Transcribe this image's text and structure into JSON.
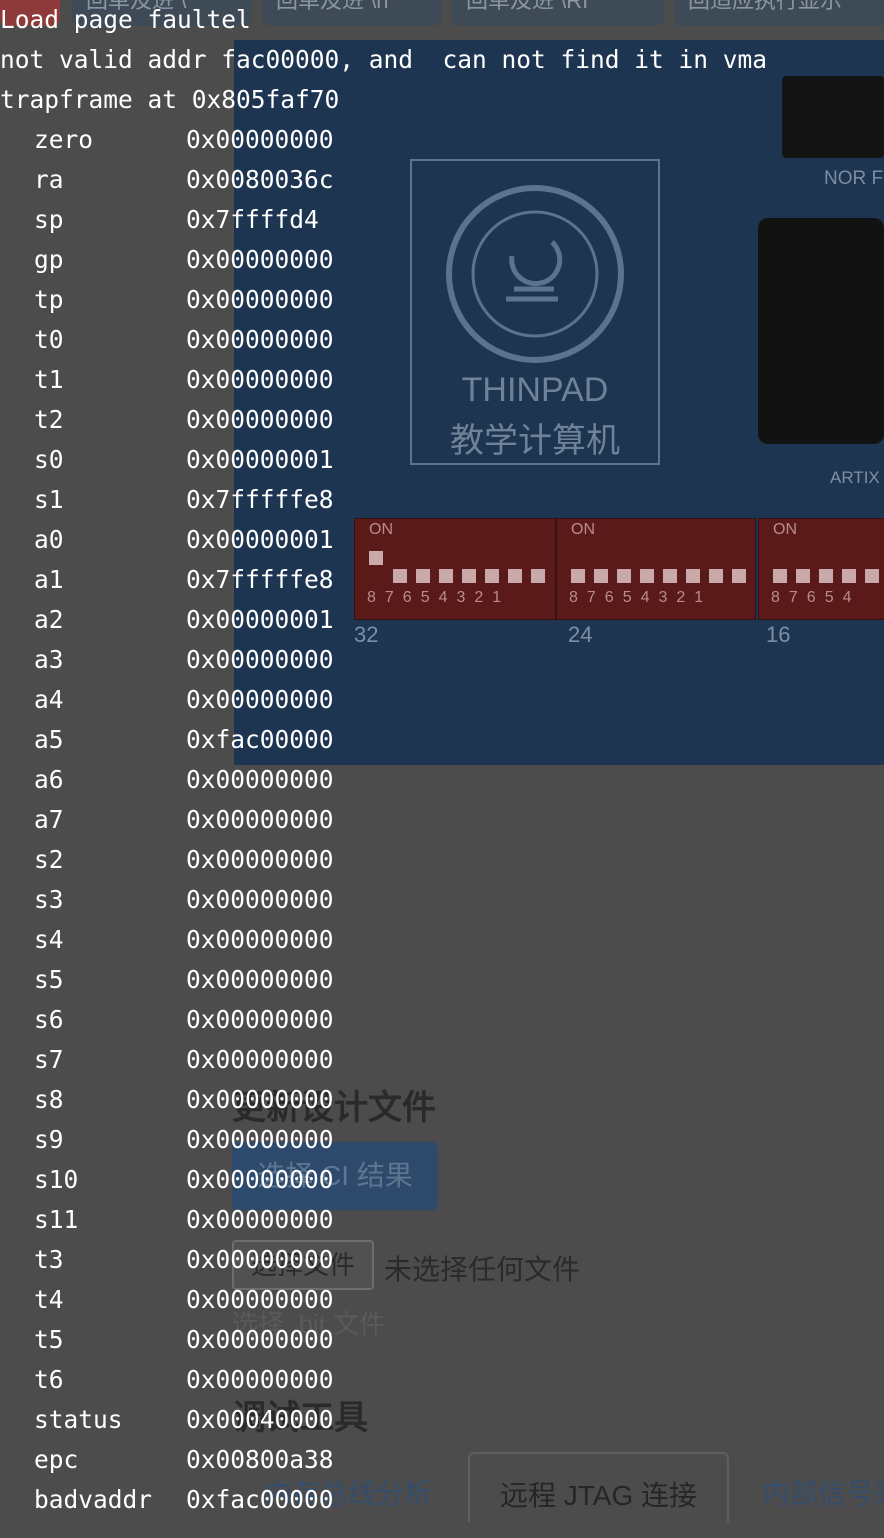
{
  "browser_tabs": [
    {
      "label": "回单及进 \\"
    },
    {
      "label": "回单及进 \\n"
    },
    {
      "label": "回单及进 \\RI"
    },
    {
      "label": "回适应执行显示"
    }
  ],
  "board": {
    "logo_title": "THINPAD",
    "logo_subtitle": "教学计算机",
    "nor_label": "NOR F",
    "artix_label": "ARTIX",
    "switch_banks": [
      {
        "on": "ON",
        "digits": "87654321",
        "index": "32"
      },
      {
        "on": "ON",
        "digits": "87654321",
        "index": "24"
      },
      {
        "on": "ON",
        "digits": "87654",
        "index": "16"
      }
    ]
  },
  "update_section": {
    "title": "更新设计文件",
    "select_ci_button": "选择 CI 结果",
    "choose_file_button": "选择文件",
    "file_status": "未选择任何文件",
    "hint": "选择 .bit 文件"
  },
  "debug_section": {
    "title": "调试工具",
    "tabs": [
      {
        "label": "内存总线分析"
      },
      {
        "label": "远程 JTAG 连接"
      },
      {
        "label": "内部信号采"
      }
    ]
  },
  "terminal": {
    "lines": [
      "Load page faultel",
      "not valid addr fac00000, and  can not find it in vma",
      "trapframe at 0x805faf70"
    ],
    "registers": [
      {
        "name": "zero",
        "value": "0x00000000"
      },
      {
        "name": "ra",
        "value": "0x0080036c"
      },
      {
        "name": "sp",
        "value": "0x7ffffd4"
      },
      {
        "name": "gp",
        "value": "0x00000000"
      },
      {
        "name": "tp",
        "value": "0x00000000"
      },
      {
        "name": "t0",
        "value": "0x00000000"
      },
      {
        "name": "t1",
        "value": "0x00000000"
      },
      {
        "name": "t2",
        "value": "0x00000000"
      },
      {
        "name": "s0",
        "value": "0x00000001"
      },
      {
        "name": "s1",
        "value": "0x7fffffe8"
      },
      {
        "name": "a0",
        "value": "0x00000001"
      },
      {
        "name": "a1",
        "value": "0x7fffffe8"
      },
      {
        "name": "a2",
        "value": "0x00000001"
      },
      {
        "name": "a3",
        "value": "0x00000000"
      },
      {
        "name": "a4",
        "value": "0x00000000"
      },
      {
        "name": "a5",
        "value": "0xfac00000"
      },
      {
        "name": "a6",
        "value": "0x00000000"
      },
      {
        "name": "a7",
        "value": "0x00000000"
      },
      {
        "name": "s2",
        "value": "0x00000000"
      },
      {
        "name": "s3",
        "value": "0x00000000"
      },
      {
        "name": "s4",
        "value": "0x00000000"
      },
      {
        "name": "s5",
        "value": "0x00000000"
      },
      {
        "name": "s6",
        "value": "0x00000000"
      },
      {
        "name": "s7",
        "value": "0x00000000"
      },
      {
        "name": "s8",
        "value": "0x00000000"
      },
      {
        "name": "s9",
        "value": "0x00000000"
      },
      {
        "name": "s10",
        "value": "0x00000000"
      },
      {
        "name": "s11",
        "value": "0x00000000"
      },
      {
        "name": "t3",
        "value": "0x00000000"
      },
      {
        "name": "t4",
        "value": "0x00000000"
      },
      {
        "name": "t5",
        "value": "0x00000000"
      },
      {
        "name": "t6",
        "value": "0x00000000"
      },
      {
        "name": "status",
        "value": "0x00040000"
      },
      {
        "name": "epc",
        "value": "0x00800a38"
      },
      {
        "name": "badvaddr",
        "value": "0xfac00000"
      }
    ]
  }
}
